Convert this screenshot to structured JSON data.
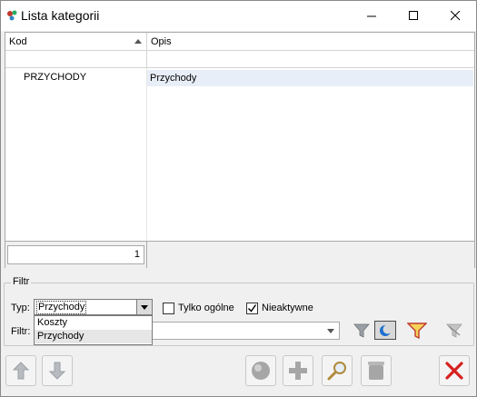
{
  "window": {
    "title": "Lista kategorii"
  },
  "grid": {
    "columns": [
      {
        "label": "Kod",
        "sort": "ascending"
      },
      {
        "label": "Opis"
      }
    ],
    "rows": [
      {
        "kod": "PRZYCHODY",
        "opis": "Przychody"
      }
    ],
    "record_count": "1"
  },
  "filter": {
    "group_label": "Filtr",
    "type_label": "Typ:",
    "type_value": "Przychody",
    "type_options": [
      "Koszty",
      "Przychody"
    ],
    "only_general_label": "Tylko ogólne",
    "only_general_checked": false,
    "inactive_label": "Nieaktywne",
    "inactive_checked": true,
    "filter_label": "Filtr:",
    "filter_value": ""
  },
  "colors": {
    "selection": "#e8eef8",
    "close_red": "#d62020",
    "accent_blue": "#1e6fd0"
  }
}
